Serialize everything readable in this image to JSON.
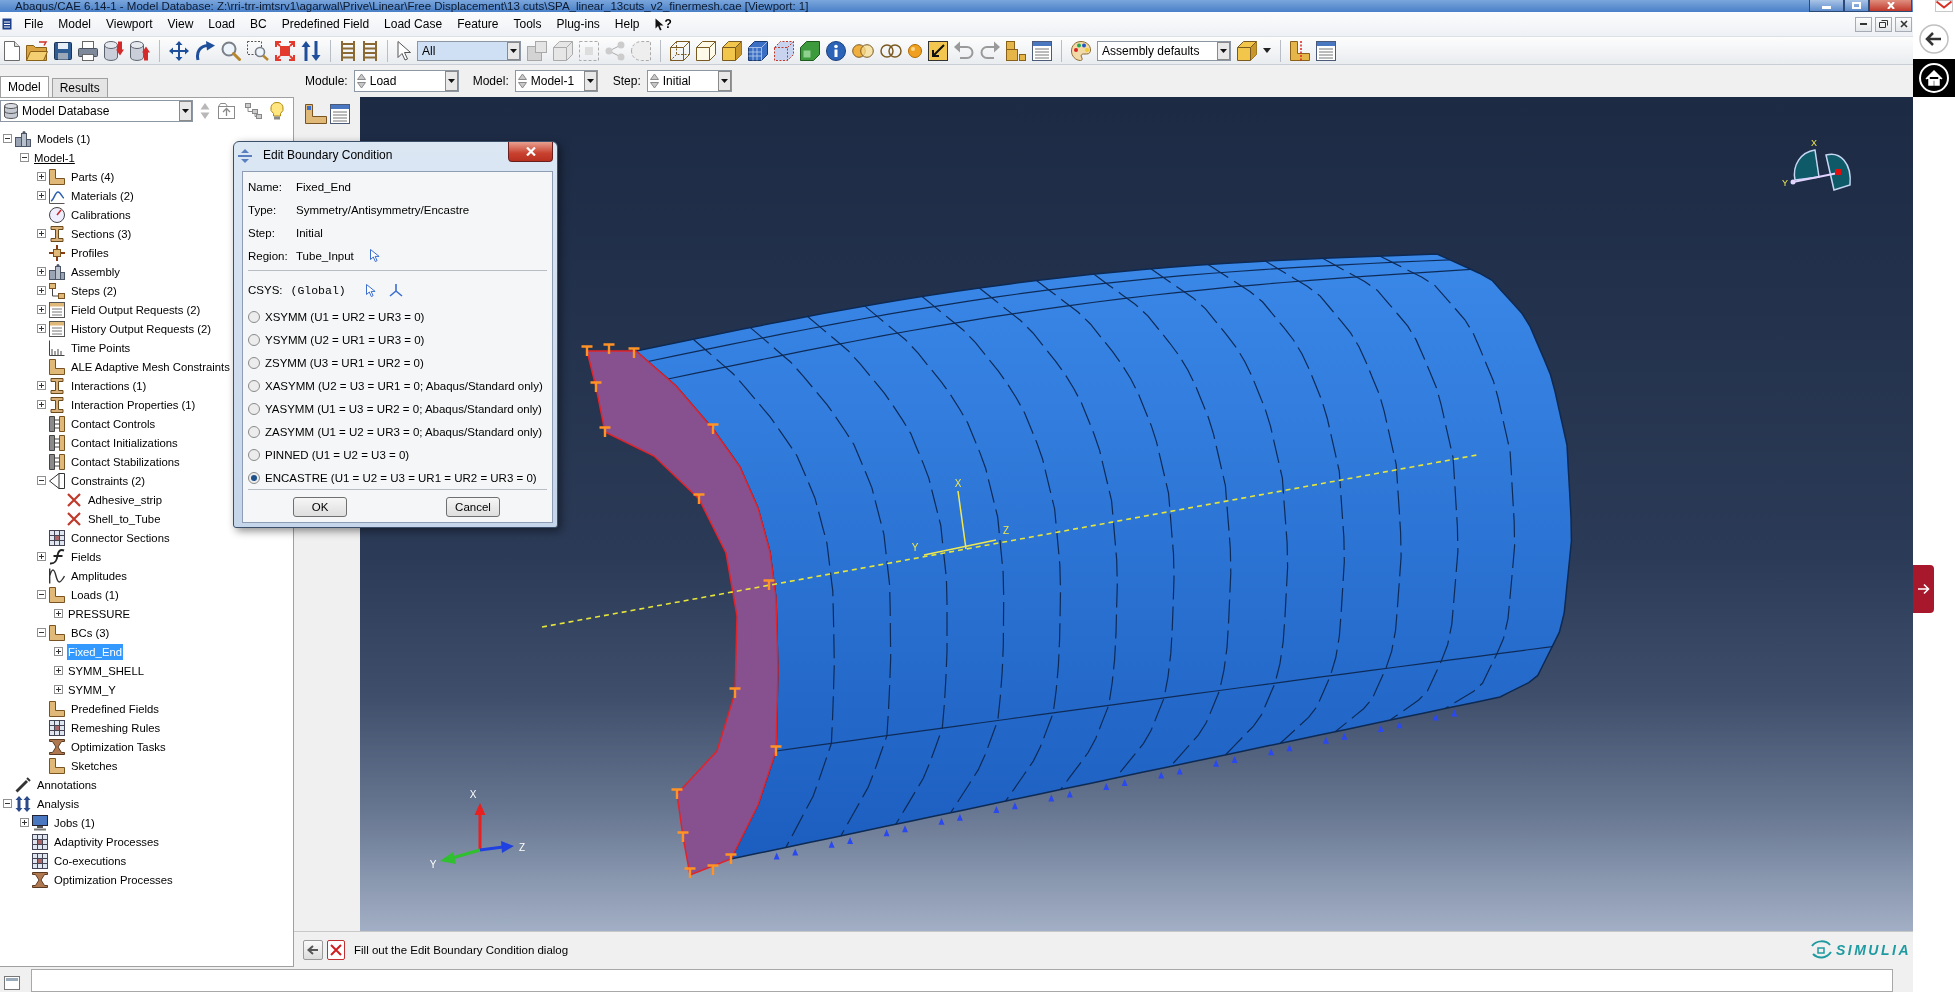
{
  "window": {
    "title": "Abaqus/CAE 6.14-1 - Model Database: Z:\\rri-trr-imtsrv1\\agarwal\\Prive\\Linear\\Free Displacement\\13 cuts\\SPA_linear_13cuts_v2_finermesh.cae [Viewport: 1]"
  },
  "menu_bar": {
    "items": [
      "File",
      "Model",
      "Viewport",
      "View",
      "Load",
      "BC",
      "Predefined Field",
      "Load Case",
      "Feature",
      "Tools",
      "Plug-ins",
      "Help"
    ],
    "help_pointer": "?"
  },
  "toolbar": {
    "selection_filter": "All",
    "render_style": "Assembly defaults"
  },
  "panel_tabs": [
    {
      "label": "Model",
      "selected": true
    },
    {
      "label": "Results",
      "selected": false
    }
  ],
  "context_bar": [
    {
      "label": "Module:",
      "value": "Load"
    },
    {
      "label": "Model:",
      "value": "Model-1"
    },
    {
      "label": "Step:",
      "value": "Initial"
    }
  ],
  "model_tree": {
    "source": "Model Database",
    "nodes": [
      {
        "label": "Models (1)",
        "expanded": true,
        "selected": false,
        "children": [
          {
            "label": "Model-1",
            "expanded": true,
            "selected": false,
            "current": true,
            "children": [
              {
                "label": "Parts (4)",
                "expanded": false,
                "selected": false
              },
              {
                "label": "Materials (2)",
                "expanded": false,
                "selected": false
              },
              {
                "label": "Calibrations",
                "selected": false
              },
              {
                "label": "Sections (3)",
                "expanded": false,
                "selected": false
              },
              {
                "label": "Profiles",
                "selected": false
              },
              {
                "label": "Assembly",
                "expanded": false,
                "selected": false
              },
              {
                "label": "Steps (2)",
                "expanded": false,
                "selected": false
              },
              {
                "label": "Field Output Requests (2)",
                "expanded": false,
                "selected": false
              },
              {
                "label": "History Output Requests (2)",
                "expanded": false,
                "selected": false
              },
              {
                "label": "Time Points",
                "selected": false
              },
              {
                "label": "ALE Adaptive Mesh Constraints",
                "selected": false
              },
              {
                "label": "Interactions (1)",
                "expanded": false,
                "selected": false
              },
              {
                "label": "Interaction Properties (1)",
                "expanded": false,
                "selected": false
              },
              {
                "label": "Contact Controls",
                "selected": false
              },
              {
                "label": "Contact Initializations",
                "selected": false
              },
              {
                "label": "Contact Stabilizations",
                "selected": false
              },
              {
                "label": "Constraints (2)",
                "expanded": true,
                "selected": false,
                "children": [
                  {
                    "label": "Adhesive_strip",
                    "selected": false
                  },
                  {
                    "label": "Shell_to_Tube",
                    "selected": false
                  }
                ]
              },
              {
                "label": "Connector Sections",
                "selected": false
              },
              {
                "label": "Fields",
                "expanded": false,
                "selected": false
              },
              {
                "label": "Amplitudes",
                "selected": false
              },
              {
                "label": "Loads (1)",
                "expanded": true,
                "selected": false,
                "children": [
                  {
                    "label": "PRESSURE",
                    "expanded": false,
                    "selected": false
                  }
                ]
              },
              {
                "label": "BCs (3)",
                "expanded": true,
                "selected": false,
                "children": [
                  {
                    "label": "Fixed_End",
                    "expanded": false,
                    "selected": true
                  },
                  {
                    "label": "SYMM_SHELL",
                    "expanded": false,
                    "selected": false
                  },
                  {
                    "label": "SYMM_Y",
                    "expanded": false,
                    "selected": false
                  }
                ]
              },
              {
                "label": "Predefined Fields",
                "selected": false
              },
              {
                "label": "Remeshing Rules",
                "selected": false
              },
              {
                "label": "Optimization Tasks",
                "selected": false
              },
              {
                "label": "Sketches",
                "selected": false
              }
            ]
          }
        ]
      },
      {
        "label": "Annotations",
        "selected": false
      },
      {
        "label": "Analysis",
        "expanded": true,
        "selected": false,
        "children": [
          {
            "label": "Jobs (1)",
            "expanded": false,
            "selected": false
          },
          {
            "label": "Adaptivity Processes",
            "selected": false
          },
          {
            "label": "Co-executions",
            "selected": false
          },
          {
            "label": "Optimization Processes",
            "selected": false
          }
        ]
      }
    ]
  },
  "viewport": {
    "csys_axes": [
      "X",
      "Y",
      "Z"
    ],
    "triad_axes": [
      "X",
      "Y",
      "Z"
    ],
    "orientation_axes": [
      "X",
      "Y"
    ]
  },
  "dialog": {
    "title": "Edit Boundary Condition",
    "fields": [
      {
        "label": "Name:",
        "value": "Fixed_End",
        "kind": "text"
      },
      {
        "label": "Type:",
        "value": "Symmetry/Antisymmetry/Encastre",
        "kind": "text"
      },
      {
        "label": "Step:",
        "value": "Initial",
        "kind": "text"
      },
      {
        "label": "Region:",
        "value": "Tube_Input",
        "kind": "pick"
      }
    ],
    "csys": {
      "label": "CSYS:",
      "value": "(Global)"
    },
    "options": [
      {
        "label": "XSYMM (U1 = UR2 = UR3 = 0)",
        "selected": false
      },
      {
        "label": "YSYMM (U2 = UR1 = UR3 = 0)",
        "selected": false
      },
      {
        "label": "ZSYMM (U3 = UR1 = UR2 = 0)",
        "selected": false
      },
      {
        "label": "XASYMM (U2 = U3 = UR1 = 0; Abaqus/Standard only)",
        "selected": false
      },
      {
        "label": "YASYMM (U1 = U3 = UR2 = 0; Abaqus/Standard only)",
        "selected": false
      },
      {
        "label": "ZASYMM (U1 = U2 = UR3 = 0; Abaqus/Standard only)",
        "selected": false
      },
      {
        "label": "PINNED (U1 = U2 = U3 = 0)",
        "selected": false
      },
      {
        "label": "ENCASTRE (U1 = U2 = U3 = UR1 = UR2 = UR3 = 0)",
        "selected": true
      }
    ],
    "buttons": [
      "OK",
      "Cancel"
    ]
  },
  "prompt": {
    "text": "Fill out the Edit Boundary Condition dialog"
  },
  "brand": {
    "name": "SIMULIA"
  }
}
